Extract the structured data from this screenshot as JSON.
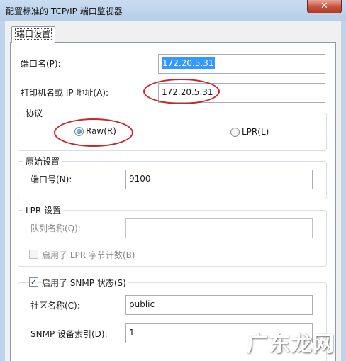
{
  "window": {
    "title": "配置标准的 TCP/IP 端口监视器",
    "close_glyph": "✕"
  },
  "tabs": [
    {
      "label": "端口设置",
      "active": true
    }
  ],
  "port_name": {
    "label": "端口名(P):",
    "value": "172.20.5.31"
  },
  "host": {
    "label": "打印机名或 IP 地址(A):",
    "value": "172.20.5.31"
  },
  "protocol": {
    "title": "协议",
    "raw": {
      "label": "Raw(R)",
      "checked": true
    },
    "lpr": {
      "label": "LPR(L)",
      "checked": false
    }
  },
  "raw_settings": {
    "title": "原始设置",
    "port_label": "端口号(N):",
    "port_value": "9100"
  },
  "lpr_settings": {
    "title": "LPR 设置",
    "queue_label": "队列名称(Q):",
    "queue_value": "",
    "byte_count_label": "启用了 LPR 字节计数(B)",
    "byte_count_checked": false
  },
  "snmp": {
    "enable_label": "启用了 SNMP 状态(S)",
    "enabled": true,
    "community_label": "社区名称(C):",
    "community_value": "public",
    "index_label": "SNMP 设备索引(D):",
    "index_value": "1"
  },
  "watermark": "广东龙网",
  "colors": {
    "annotation": "#c9262a",
    "selection": "#3399ff",
    "close": "#c7503b"
  }
}
